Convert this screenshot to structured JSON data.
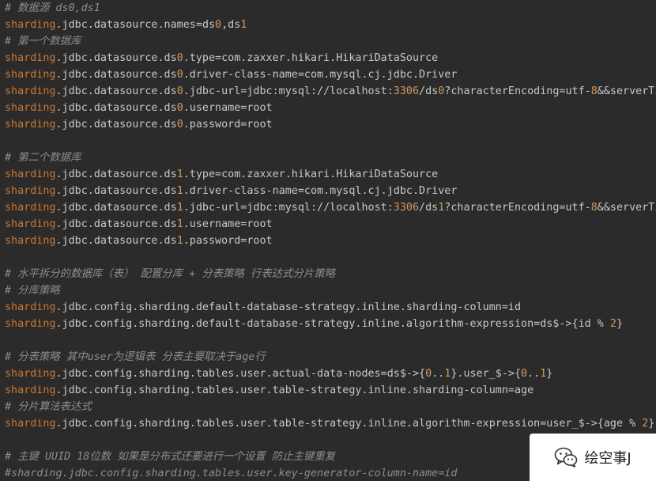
{
  "theme": {
    "background": "#2b2b2b",
    "plain": "#c8c8c8",
    "comment": "#8d8d8d",
    "key": "#cc7832",
    "number": "#d09a5a"
  },
  "lines": [
    [
      {
        "t": "# 数据源 ds0,ds1",
        "c": "comment"
      }
    ],
    [
      {
        "t": "sharding",
        "c": "key"
      },
      {
        "t": ".jdbc.datasource.names=ds",
        "c": "plain"
      },
      {
        "t": "0",
        "c": "number"
      },
      {
        "t": ",ds",
        "c": "plain"
      },
      {
        "t": "1",
        "c": "number"
      }
    ],
    [
      {
        "t": "# 第一个数据库",
        "c": "comment"
      }
    ],
    [
      {
        "t": "sharding",
        "c": "key"
      },
      {
        "t": ".jdbc.datasource.ds",
        "c": "plain"
      },
      {
        "t": "0",
        "c": "number"
      },
      {
        "t": ".type=com.zaxxer.hikari.HikariDataSource",
        "c": "plain"
      }
    ],
    [
      {
        "t": "sharding",
        "c": "key"
      },
      {
        "t": ".jdbc.datasource.ds",
        "c": "plain"
      },
      {
        "t": "0",
        "c": "number"
      },
      {
        "t": ".driver-class-name=com.mysql.cj.jdbc.Driver",
        "c": "plain"
      }
    ],
    [
      {
        "t": "sharding",
        "c": "key"
      },
      {
        "t": ".jdbc.datasource.ds",
        "c": "plain"
      },
      {
        "t": "0",
        "c": "number"
      },
      {
        "t": ".jdbc-url=jdbc:mysql://localhost:",
        "c": "plain"
      },
      {
        "t": "3306",
        "c": "number"
      },
      {
        "t": "/ds",
        "c": "plain"
      },
      {
        "t": "0",
        "c": "number"
      },
      {
        "t": "?characterEncoding=utf-",
        "c": "plain"
      },
      {
        "t": "8",
        "c": "number"
      },
      {
        "t": "&&serverTimezone=UTC",
        "c": "plain"
      }
    ],
    [
      {
        "t": "sharding",
        "c": "key"
      },
      {
        "t": ".jdbc.datasource.ds",
        "c": "plain"
      },
      {
        "t": "0",
        "c": "number"
      },
      {
        "t": ".username=root",
        "c": "plain"
      }
    ],
    [
      {
        "t": "sharding",
        "c": "key"
      },
      {
        "t": ".jdbc.datasource.ds",
        "c": "plain"
      },
      {
        "t": "0",
        "c": "number"
      },
      {
        "t": ".password=root",
        "c": "plain"
      }
    ],
    [],
    [
      {
        "t": "# 第二个数据库",
        "c": "comment"
      }
    ],
    [
      {
        "t": "sharding",
        "c": "key"
      },
      {
        "t": ".jdbc.datasource.ds",
        "c": "plain"
      },
      {
        "t": "1",
        "c": "number"
      },
      {
        "t": ".type=com.zaxxer.hikari.HikariDataSource",
        "c": "plain"
      }
    ],
    [
      {
        "t": "sharding",
        "c": "key"
      },
      {
        "t": ".jdbc.datasource.ds",
        "c": "plain"
      },
      {
        "t": "1",
        "c": "number"
      },
      {
        "t": ".driver-class-name=com.mysql.cj.jdbc.Driver",
        "c": "plain"
      }
    ],
    [
      {
        "t": "sharding",
        "c": "key"
      },
      {
        "t": ".jdbc.datasource.ds",
        "c": "plain"
      },
      {
        "t": "1",
        "c": "number"
      },
      {
        "t": ".jdbc-url=jdbc:mysql://localhost:",
        "c": "plain"
      },
      {
        "t": "3306",
        "c": "number"
      },
      {
        "t": "/ds",
        "c": "plain"
      },
      {
        "t": "1",
        "c": "number"
      },
      {
        "t": "?characterEncoding=utf-",
        "c": "plain"
      },
      {
        "t": "8",
        "c": "number"
      },
      {
        "t": "&&serverTimezone=UTC",
        "c": "plain"
      }
    ],
    [
      {
        "t": "sharding",
        "c": "key"
      },
      {
        "t": ".jdbc.datasource.ds",
        "c": "plain"
      },
      {
        "t": "1",
        "c": "number"
      },
      {
        "t": ".username=root",
        "c": "plain"
      }
    ],
    [
      {
        "t": "sharding",
        "c": "key"
      },
      {
        "t": ".jdbc.datasource.ds",
        "c": "plain"
      },
      {
        "t": "1",
        "c": "number"
      },
      {
        "t": ".password=root",
        "c": "plain"
      }
    ],
    [],
    [
      {
        "t": "# 水平拆分的数据库（表） 配置分库 + 分表策略 行表达式分片策略",
        "c": "comment"
      }
    ],
    [
      {
        "t": "# 分库策略",
        "c": "comment"
      }
    ],
    [
      {
        "t": "sharding",
        "c": "key"
      },
      {
        "t": ".jdbc.config.sharding.default-database-strategy.inline.sharding-column=id",
        "c": "plain"
      }
    ],
    [
      {
        "t": "sharding",
        "c": "key"
      },
      {
        "t": ".jdbc.config.sharding.default-database-strategy.inline.algorithm-expression=ds$->{id % ",
        "c": "plain"
      },
      {
        "t": "2",
        "c": "number"
      },
      {
        "t": "}",
        "c": "plain"
      }
    ],
    [],
    [
      {
        "t": "# 分表策略 其中user为逻辑表 分表主要取决于age行",
        "c": "comment"
      }
    ],
    [
      {
        "t": "sharding",
        "c": "key"
      },
      {
        "t": ".jdbc.config.sharding.tables.user.actual-data-nodes=ds$->{",
        "c": "plain"
      },
      {
        "t": "0",
        "c": "number"
      },
      {
        "t": "..",
        "c": "plain"
      },
      {
        "t": "1",
        "c": "number"
      },
      {
        "t": "}.user_$->{",
        "c": "plain"
      },
      {
        "t": "0",
        "c": "number"
      },
      {
        "t": "..",
        "c": "plain"
      },
      {
        "t": "1",
        "c": "number"
      },
      {
        "t": "}",
        "c": "plain"
      }
    ],
    [
      {
        "t": "sharding",
        "c": "key"
      },
      {
        "t": ".jdbc.config.sharding.tables.user.table-strategy.inline.sharding-column=age",
        "c": "plain"
      }
    ],
    [
      {
        "t": "# 分片算法表达式",
        "c": "comment"
      }
    ],
    [
      {
        "t": "sharding",
        "c": "key"
      },
      {
        "t": ".jdbc.config.sharding.tables.user.table-strategy.inline.algorithm-expression=user_$->{age % ",
        "c": "plain"
      },
      {
        "t": "2",
        "c": "number"
      },
      {
        "t": "}",
        "c": "plain"
      }
    ],
    [],
    [
      {
        "t": "# 主键 UUID 18位数 如果是分布式还要进行一个设置 防止主键重复",
        "c": "comment"
      }
    ],
    [
      {
        "t": "#sharding.jdbc.config.sharding.tables.user.key-generator-column-name=id",
        "c": "comment"
      }
    ]
  ],
  "watermark": {
    "icon": "wechat-icon",
    "text": "绘空事J"
  }
}
